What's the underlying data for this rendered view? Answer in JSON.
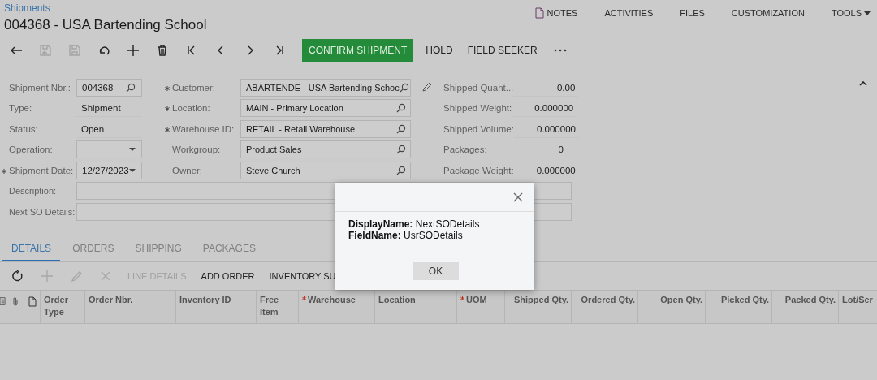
{
  "breadcrumb": "Shipments",
  "title": "004368 - USA Bartending School",
  "top_links": [
    {
      "label": "NOTES",
      "kind": "notes"
    },
    {
      "label": "ACTIVITIES",
      "kind": "plain"
    },
    {
      "label": "FILES",
      "kind": "plain"
    },
    {
      "label": "CUSTOMIZATION",
      "kind": "plain"
    },
    {
      "label": "TOOLS",
      "kind": "menu"
    }
  ],
  "toolbar": {
    "icons": [
      {
        "kind": "back",
        "disabled": false
      },
      {
        "kind": "save-close",
        "disabled": true
      },
      {
        "kind": "save",
        "disabled": true
      },
      {
        "kind": "undo",
        "disabled": false
      },
      {
        "kind": "add",
        "disabled": false
      },
      {
        "kind": "delete",
        "disabled": false
      },
      {
        "kind": "first",
        "disabled": false
      },
      {
        "kind": "prev",
        "disabled": false
      },
      {
        "kind": "next",
        "disabled": false
      },
      {
        "kind": "last",
        "disabled": false
      }
    ],
    "buttons": [
      {
        "label": "CONFIRM SHIPMENT",
        "primary": true
      },
      {
        "label": "HOLD",
        "primary": false
      },
      {
        "label": "FIELD SEEKER",
        "primary": false
      }
    ]
  },
  "form": {
    "column_1": [
      {
        "label": "Shipment Nbr.:",
        "required": false,
        "kind": "lookup",
        "value": "004368"
      },
      {
        "label": "Type:",
        "required": false,
        "kind": "text",
        "value": "Shipment"
      },
      {
        "label": "Status:",
        "required": false,
        "kind": "text",
        "value": "Open"
      },
      {
        "label": "Operation:",
        "required": false,
        "kind": "select"
      },
      {
        "label": "Shipment Date:",
        "required": true,
        "kind": "select",
        "value": "12/27/2023"
      }
    ],
    "column_2": [
      {
        "label": "Customer:",
        "required": true,
        "value": "ABARTENDE - USA Bartending Schoc",
        "has_edit": true
      },
      {
        "label": "Location:",
        "required": true,
        "value": "MAIN - Primary Location",
        "has_edit": false
      },
      {
        "label": "Warehouse ID:",
        "required": true,
        "value": "RETAIL - Retail Warehouse",
        "has_edit": false
      },
      {
        "label": "Workgroup:",
        "required": false,
        "value": "Product Sales",
        "has_edit": false
      },
      {
        "label": "Owner:",
        "required": false,
        "value": "Steve Church",
        "has_edit": false
      }
    ],
    "column_3": [
      {
        "label": "Shipped Quant...",
        "value": "0.00"
      },
      {
        "label": "Shipped Weight:",
        "value": "0.000000"
      },
      {
        "label": "Shipped Volume:",
        "value": "0.000000"
      },
      {
        "label": "Packages:",
        "value": "0"
      },
      {
        "label": "Package Weight:",
        "value": "0.000000"
      }
    ],
    "wide": [
      {
        "label": "Description:"
      },
      {
        "label": "Next SO Details:"
      }
    ]
  },
  "tabs": [
    {
      "label": "DETAILS",
      "selected": true
    },
    {
      "label": "ORDERS",
      "selected": false
    },
    {
      "label": "SHIPPING",
      "selected": false
    },
    {
      "label": "PACKAGES",
      "selected": false
    }
  ],
  "grid_toolbar": {
    "icons": [
      {
        "kind": "refresh",
        "disabled": false
      },
      {
        "kind": "add",
        "disabled": true
      },
      {
        "kind": "edit",
        "disabled": true
      },
      {
        "kind": "close",
        "disabled": true
      }
    ],
    "buttons": [
      {
        "label": "LINE DETAILS",
        "disabled": true
      },
      {
        "label": "ADD ORDER",
        "disabled": false
      },
      {
        "label": "INVENTORY SU",
        "disabled": false
      }
    ]
  },
  "grid": {
    "columns": [
      {
        "kind": "icon"
      },
      {
        "kind": "icon"
      },
      {
        "kind": "icon"
      },
      {
        "kind": "text",
        "label": "Order Type",
        "required": false
      },
      {
        "kind": "text",
        "label": "Order Nbr.",
        "required": false
      },
      {
        "kind": "text",
        "label": "Inventory ID",
        "required": false
      },
      {
        "kind": "text",
        "label": "Free Item",
        "required": false
      },
      {
        "kind": "text",
        "label": "Warehouse",
        "required": true
      },
      {
        "kind": "text",
        "label": "Location",
        "required": false
      },
      {
        "kind": "text",
        "label": "UOM",
        "required": true
      },
      {
        "kind": "number",
        "label": "Shipped Qty.",
        "required": false
      },
      {
        "kind": "number",
        "label": "Ordered Qty.",
        "required": false
      },
      {
        "kind": "number",
        "label": "Open Qty.",
        "required": false
      },
      {
        "kind": "number",
        "label": "Picked Qty.",
        "required": false
      },
      {
        "kind": "number",
        "label": "Packed Qty.",
        "required": false
      },
      {
        "kind": "text",
        "label": "Lot/Ser",
        "required": false
      }
    ]
  },
  "dialog": {
    "lines": [
      "**DisplayName:** NextSODetails",
      "**FieldName:** UsrSODetails"
    ],
    "button": "OK"
  }
}
